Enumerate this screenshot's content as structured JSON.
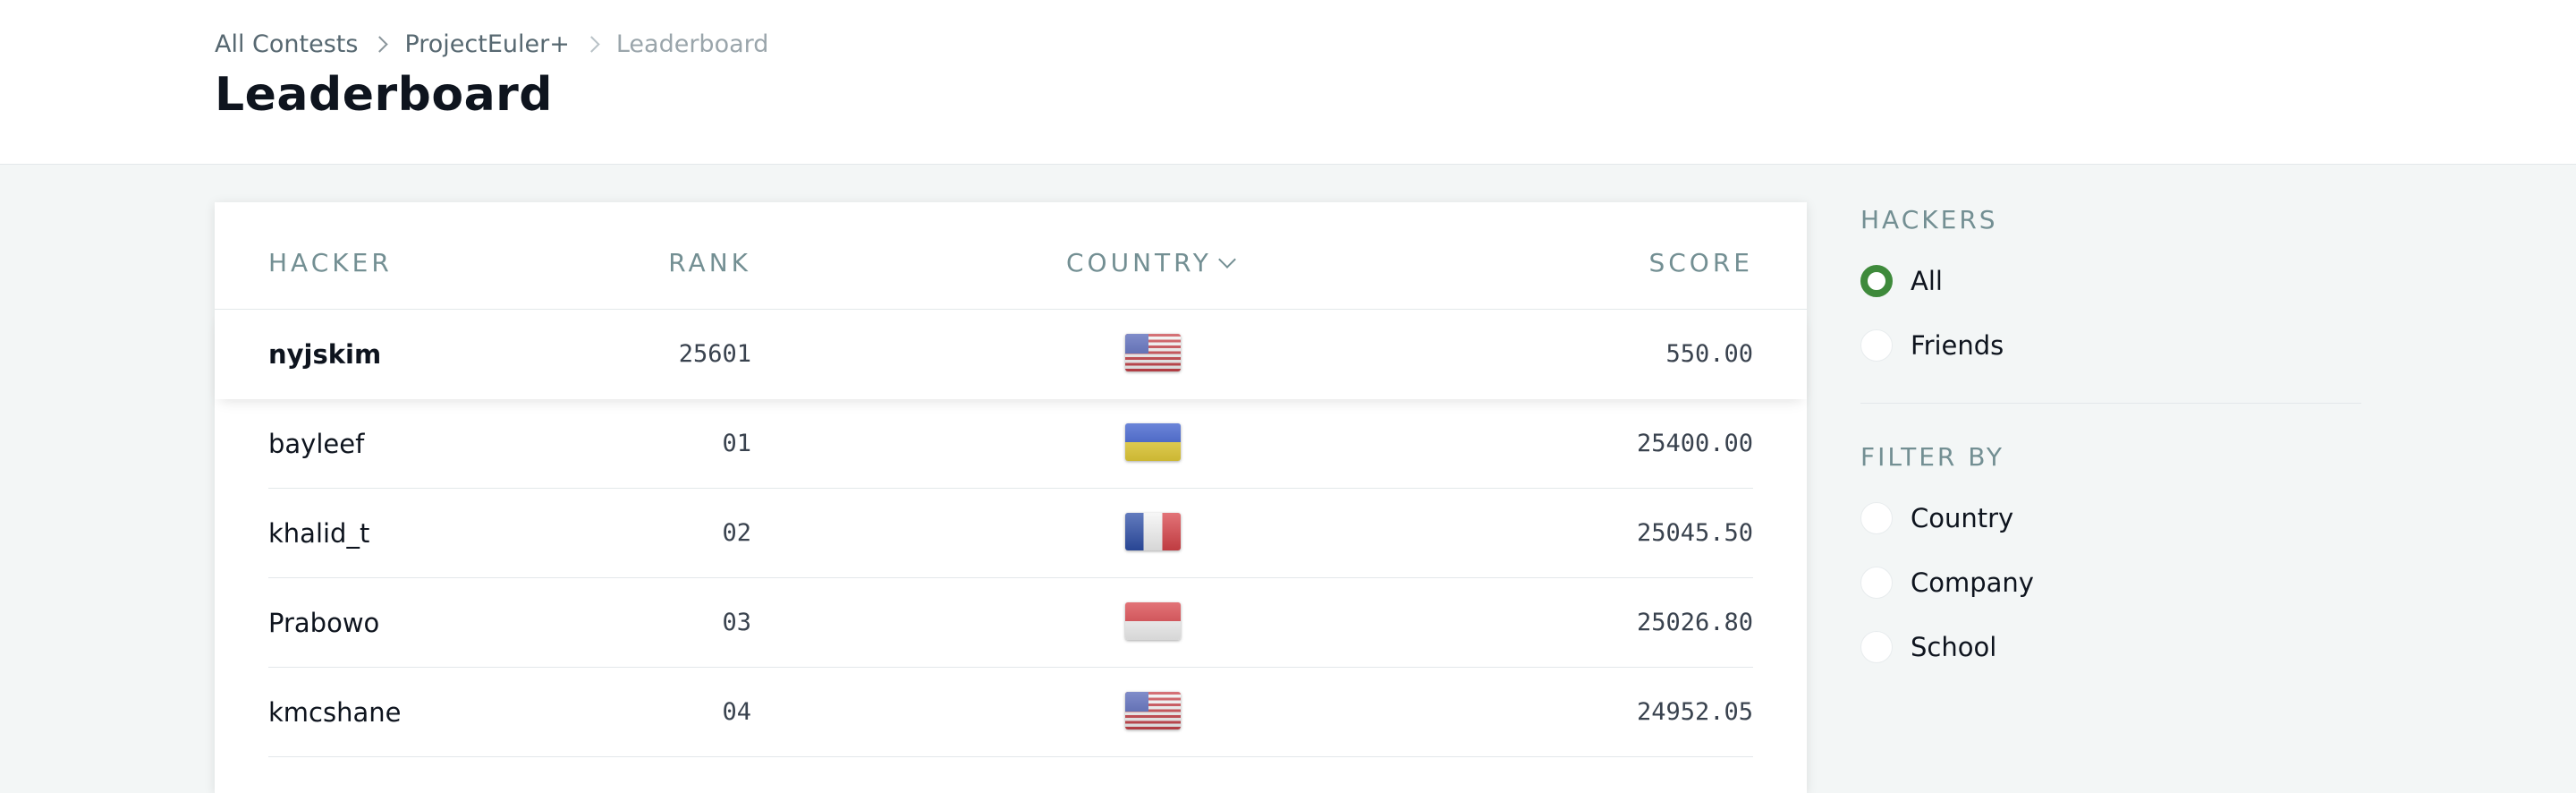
{
  "breadcrumb": {
    "items": [
      "All Contests",
      "ProjectEuler+",
      "Leaderboard"
    ]
  },
  "page": {
    "title": "Leaderboard"
  },
  "table": {
    "columns": {
      "hacker": "HACKER",
      "rank": "RANK",
      "country": "COUNTRY",
      "score": "SCORE"
    },
    "current_user": {
      "name": "nyjskim",
      "rank": "25601",
      "country_flag": "us-flag",
      "score": "550.00"
    },
    "rows": [
      {
        "name": "bayleef",
        "rank": "01",
        "country_flag": "ua-flag",
        "score": "25400.00"
      },
      {
        "name": "khalid_t",
        "rank": "02",
        "country_flag": "fr-flag",
        "score": "25045.50"
      },
      {
        "name": "Prabowo",
        "rank": "03",
        "country_flag": "id-flag",
        "score": "25026.80"
      },
      {
        "name": "kmcshane",
        "rank": "04",
        "country_flag": "us-flag",
        "score": "24952.05"
      }
    ]
  },
  "sidebar": {
    "hackers_heading": "HACKERS",
    "hackers_options": [
      {
        "label": "All",
        "selected": true
      },
      {
        "label": "Friends",
        "selected": false
      }
    ],
    "filter_heading": "FILTER BY",
    "filter_options": [
      {
        "label": "Country"
      },
      {
        "label": "Company"
      },
      {
        "label": "School"
      }
    ]
  },
  "colors": {
    "accent_green": "#3e8a3b",
    "muted_heading": "#738f93",
    "page_bg": "#f3f6f6"
  }
}
